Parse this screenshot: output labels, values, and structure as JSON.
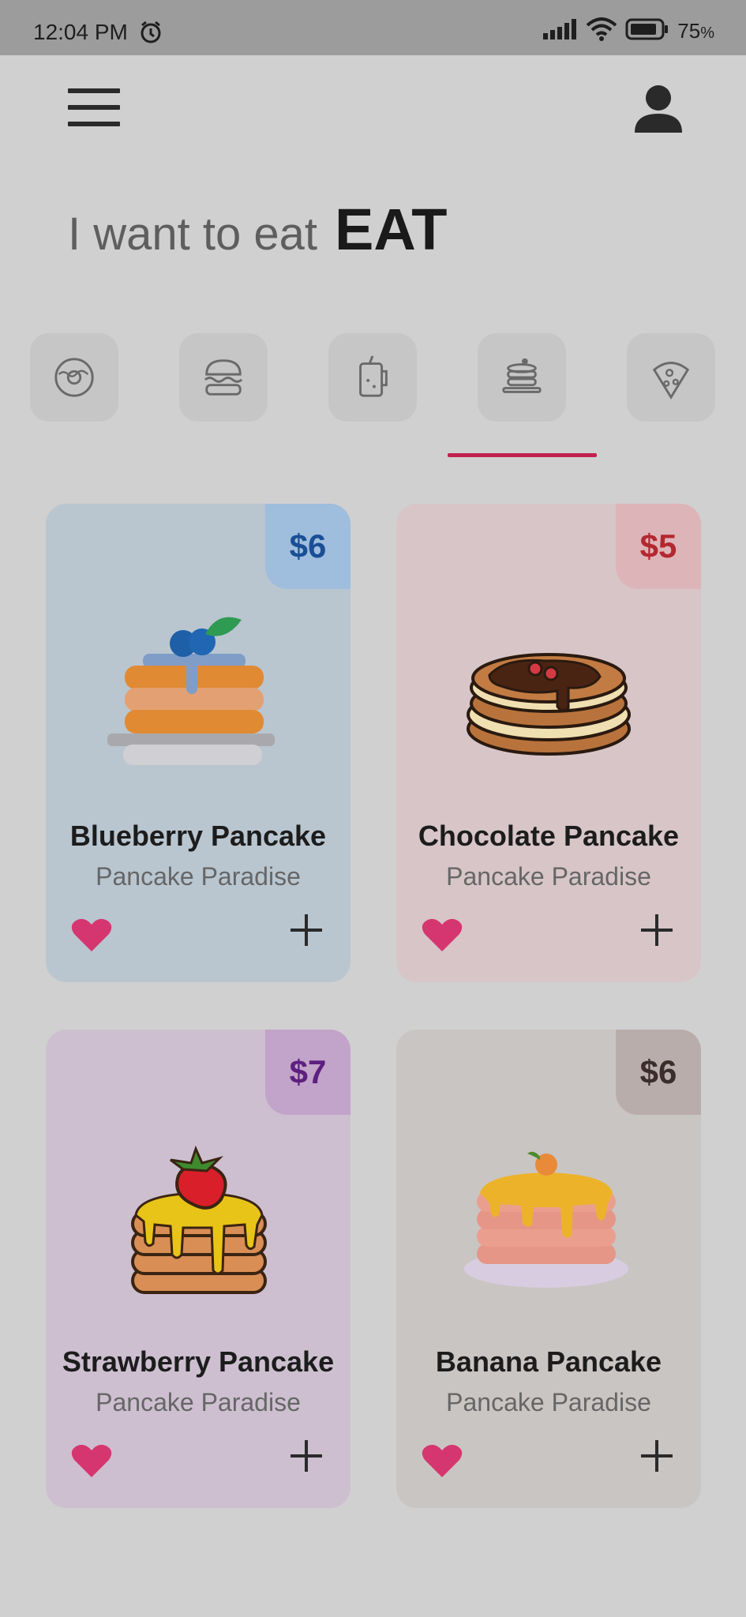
{
  "status_bar": {
    "time": "12:04 PM",
    "battery_percent": "75",
    "battery_unit": "%"
  },
  "header": {
    "menu_icon": "hamburger-menu-icon",
    "profile_icon": "user-icon"
  },
  "headline": {
    "lead": "I want to eat",
    "emphasis": "EAT"
  },
  "categories": [
    {
      "icon": "donut-icon",
      "selected": false
    },
    {
      "icon": "burger-icon",
      "selected": false
    },
    {
      "icon": "drink-jar-icon",
      "selected": false
    },
    {
      "icon": "pancake-icon",
      "selected": true
    },
    {
      "icon": "pizza-icon",
      "selected": false
    }
  ],
  "colors": {
    "accent": "#c0214f",
    "heart": "#d6366f"
  },
  "products": [
    {
      "name": "Blueberry Pancake",
      "vendor": "Pancake Paradise",
      "price": "$6",
      "image_icon": "blueberry-pancake-icon"
    },
    {
      "name": "Chocolate Pancake",
      "vendor": "Pancake Paradise",
      "price": "$5",
      "image_icon": "chocolate-pancake-icon"
    },
    {
      "name": "Strawberry Pancake",
      "vendor": "Pancake Paradise",
      "price": "$7",
      "image_icon": "strawberry-pancake-icon"
    },
    {
      "name": "Banana Pancake",
      "vendor": "Pancake Paradise",
      "price": "$6",
      "image_icon": "banana-pancake-icon"
    }
  ]
}
